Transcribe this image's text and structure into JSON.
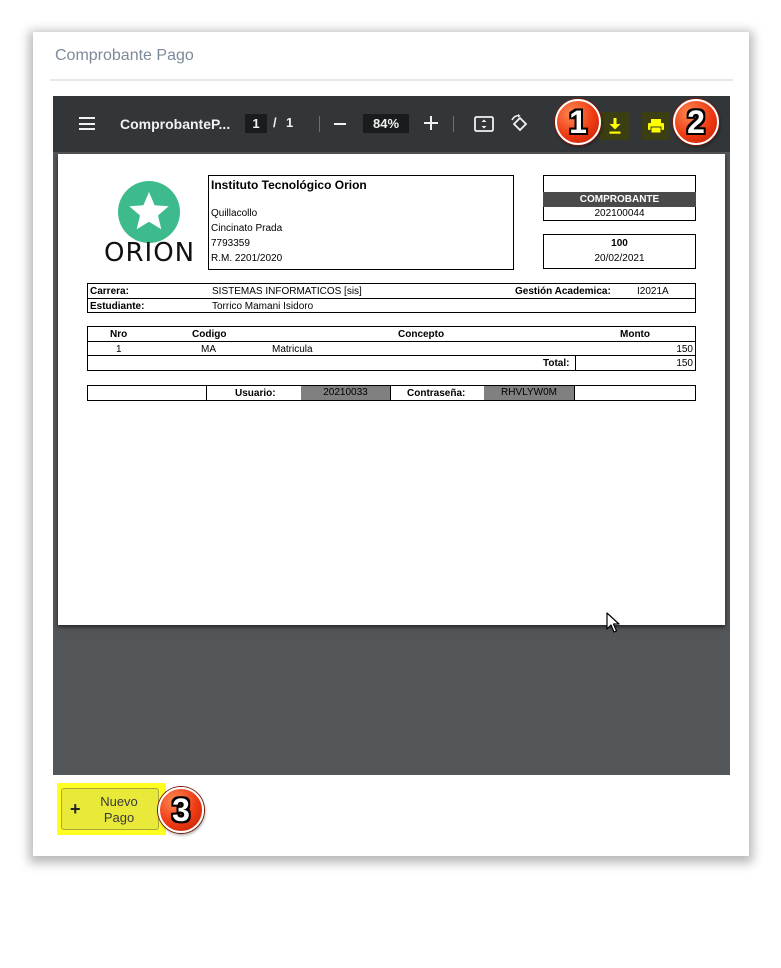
{
  "card": {
    "title": "Comprobante Pago"
  },
  "viewer": {
    "doc_title": "ComprobanteP...",
    "page_current": "1",
    "page_separator": "/",
    "page_total": "1",
    "zoom": "84%",
    "icons": [
      "menu-icon",
      "zoom-out-icon",
      "zoom-in-icon",
      "fit-page-icon",
      "rotate-icon",
      "download-icon",
      "print-icon"
    ],
    "highlight_color": "#ffff00"
  },
  "receipt": {
    "institution": {
      "name": "Instituto Tecnológico Orion",
      "city": "Quillacollo",
      "street": "Cincinato Prada",
      "phone": "7793359",
      "rm": "R.M. 2201/2020"
    },
    "logo_text": "ORION",
    "logo_color": "#3dbb8c",
    "comprobante_label": "COMPROBANTE",
    "comprobante_number": "202100044",
    "amount_box": "100",
    "date": "20/02/2021",
    "career_label": "Carrera:",
    "career_value": "SISTEMAS INFORMATICOS [sis]",
    "gestion_label": "Gestión Academica:",
    "gestion_value": "I2021A",
    "student_label": "Estudiante:",
    "student_value": "Torrico  Mamani Isidoro",
    "table": {
      "headers": [
        "Nro",
        "Codigo",
        "Concepto",
        "Monto"
      ],
      "rows": [
        {
          "nro": "1",
          "codigo": "MA",
          "concepto": "Matricula",
          "monto": "150"
        }
      ],
      "total_label": "Total:",
      "total_value": "150"
    },
    "usuario_label": "Usuario:",
    "usuario_value": "20210033",
    "password_label": "Contraseña:",
    "password_value": "RHVLYW0M"
  },
  "callouts": [
    "1",
    "2",
    "3"
  ],
  "actions": {
    "nuevo_pago_plus": "+",
    "nuevo_pago_label": "Nuevo Pago",
    "button_color": "#e9e93a"
  }
}
